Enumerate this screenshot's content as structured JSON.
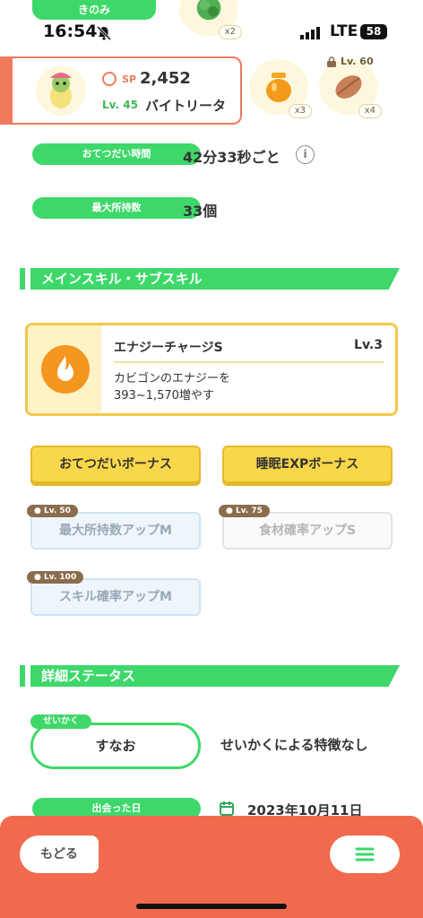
{
  "top_pill_label": "きのみ",
  "status": {
    "time": "16:54",
    "network": "LTE",
    "battery": "58"
  },
  "ingredients": [
    {
      "count": "x2"
    },
    {
      "count": "x3"
    },
    {
      "count": "x4",
      "lock_level": "Lv. 60"
    }
  ],
  "pokemon": {
    "sp_label": "SP",
    "sp_value": "2,452",
    "level": "Lv. 45",
    "name": "バイトリータ"
  },
  "help_time": {
    "label": "おてつだい時間",
    "value": "42分33秒ごと",
    "info": "i"
  },
  "max_carry": {
    "label": "最大所持数",
    "value": "33個"
  },
  "skills_section_title": "メインスキル・サブスキル",
  "main_skill": {
    "name": "エナジーチャージS",
    "level": "Lv.3",
    "desc_line1": "カビゴンのエナジーを",
    "desc_line2": "393~1,570増やす"
  },
  "sub_skills": [
    {
      "label": "おてつだいボーナス"
    },
    {
      "label": "睡眠EXPボーナス"
    },
    {
      "label": "最大所持数アップM",
      "lock": "Lv. 50"
    },
    {
      "label": "食材確率アップS",
      "lock": "Lv. 75"
    },
    {
      "label": "スキル確率アップM",
      "lock": "Lv. 100"
    }
  ],
  "details_section_title": "詳細ステータス",
  "nature": {
    "tag": "せいかく",
    "value": "すなお",
    "desc": "せいかくによる特徴なし"
  },
  "met_date": {
    "label": "出会った日",
    "value": "2023年10月11日"
  },
  "nav": {
    "back_label": "もどる"
  },
  "colors": {
    "green": "#3ed86a",
    "coral": "#f16a4e",
    "yellow": "#f9d74a"
  }
}
